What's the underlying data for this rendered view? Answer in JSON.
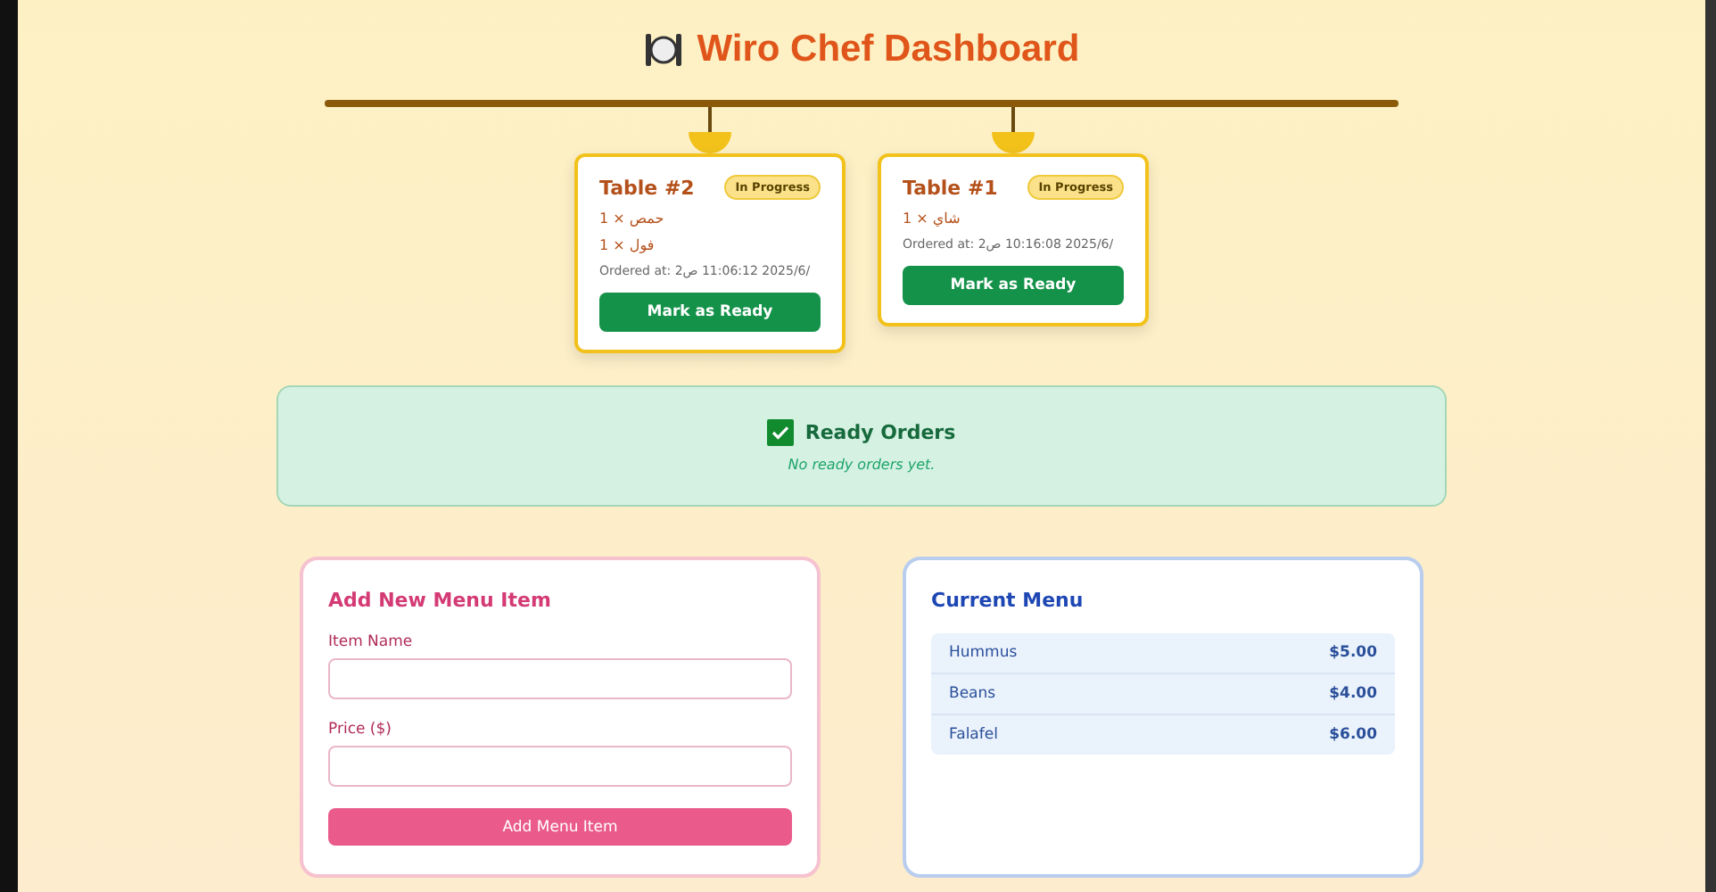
{
  "header": {
    "title": "Wiro Chef Dashboard"
  },
  "orders": [
    {
      "table": "Table #2",
      "status": "In Progress",
      "items": [
        "حمص × 1",
        "فول × 1"
      ],
      "ordered_at": "Ordered at: 2ص 11:06:12 2025/6/",
      "action": "Mark as Ready"
    },
    {
      "table": "Table #1",
      "status": "In Progress",
      "items": [
        "شاي × 1"
      ],
      "ordered_at": "Ordered at: 2ص 10:16:08 2025/6/",
      "action": "Mark as Ready"
    }
  ],
  "ready": {
    "title": "Ready Orders",
    "empty_text": "No ready orders yet."
  },
  "add_form": {
    "title": "Add New Menu Item",
    "fields": [
      {
        "label": "Item Name"
      },
      {
        "label": "Price ($)"
      }
    ],
    "submit": "Add Menu Item"
  },
  "menu": {
    "title": "Current Menu",
    "items": [
      {
        "name": "Hummus",
        "price": "$5.00"
      },
      {
        "name": "Beans",
        "price": "$4.00"
      },
      {
        "name": "Falafel",
        "price": "$6.00"
      }
    ]
  }
}
